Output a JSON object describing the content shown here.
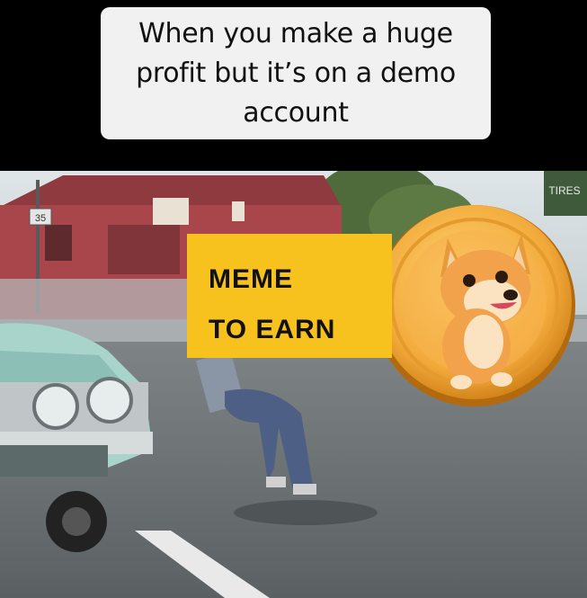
{
  "caption": {
    "lines": [
      "When you make a huge",
      "profit but it’s on a demo",
      "account"
    ]
  },
  "badge": {
    "lines": [
      "MEME",
      "TO EARN"
    ],
    "color": "#f7c21d"
  },
  "scene": {
    "speed_sign": "35",
    "shop_sign": "TIRES"
  },
  "coin": {
    "icon": "shiba-dog-coin-icon"
  }
}
